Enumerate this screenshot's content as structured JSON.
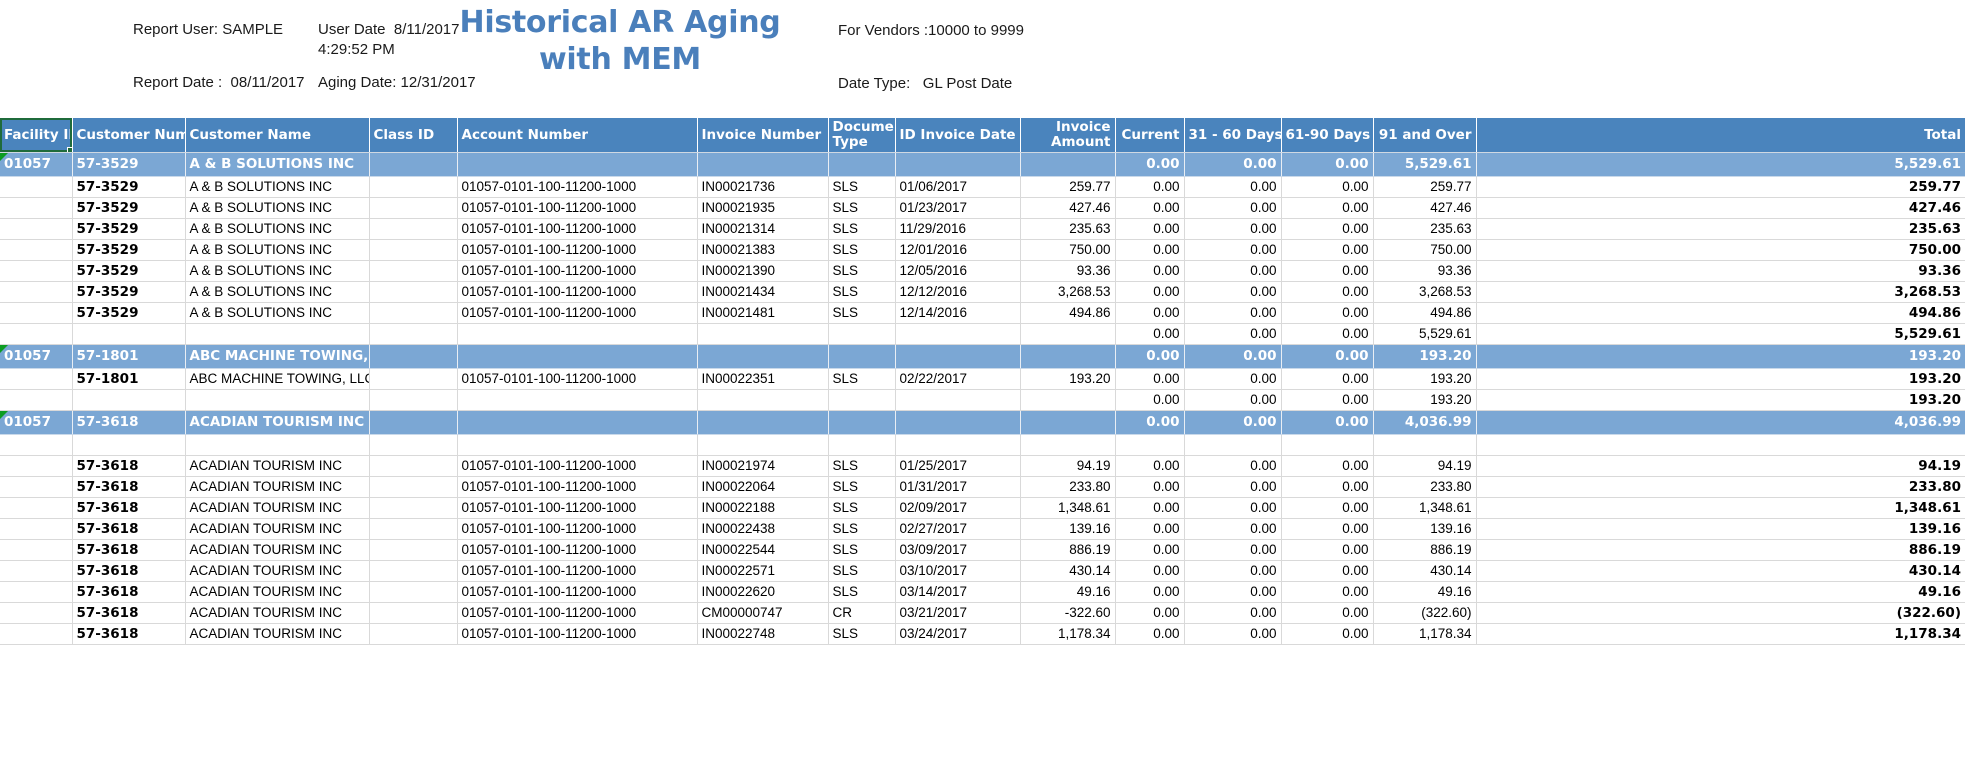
{
  "header": {
    "title_line1": "Historical AR Aging",
    "title_line2": "with MEM",
    "title_color": "#4a7fbb",
    "report_user": "Report User: SAMPLE",
    "user_date": "User Date  8/11/2017",
    "user_time": "4:29:52 PM",
    "report_date": "Report Date :  08/11/2017",
    "aging_date": "Aging Date: 12/31/2017",
    "for_vendors": "For Vendors :10000 to 9999",
    "date_type": "Date Type:   GL Post Date"
  },
  "table": {
    "columns": [
      "Facility ID",
      "Customer Number",
      "Customer Name",
      "Class ID",
      "Account Number",
      "Invoice Number",
      "Document Type",
      "ID Invoice Date",
      "Invoice Amount",
      "Current",
      "31 - 60 Days",
      "61-90 Days",
      "91 and Over",
      "Total"
    ],
    "selected_header": "Facility ID",
    "header_bg": "#4a84bd",
    "group_bg": "#7ba7d4",
    "rows": [
      {
        "kind": "group",
        "flagged": true,
        "facility": "01057",
        "customer_number": "57-3529",
        "customer_name": "A & B SOLUTIONS INC",
        "class_id": "",
        "account_number": "",
        "invoice_number": "",
        "doc_type": "",
        "invoice_date": "",
        "invoice_amount": "",
        "current": "0.00",
        "d31_60": "0.00",
        "d61_90": "0.00",
        "d91_over": "5,529.61",
        "total": "5,529.61"
      },
      {
        "kind": "detail",
        "facility": "",
        "customer_number": "57-3529",
        "customer_name": "A & B SOLUTIONS INC",
        "class_id": "",
        "account_number": "01057-0101-100-11200-1000",
        "invoice_number": "IN00021736",
        "doc_type": "SLS",
        "invoice_date": "01/06/2017",
        "invoice_amount": "259.77",
        "current": "0.00",
        "d31_60": "0.00",
        "d61_90": "0.00",
        "d91_over": "259.77",
        "total": "259.77"
      },
      {
        "kind": "detail",
        "facility": "",
        "customer_number": "57-3529",
        "customer_name": "A & B SOLUTIONS INC",
        "class_id": "",
        "account_number": "01057-0101-100-11200-1000",
        "invoice_number": "IN00021935",
        "doc_type": "SLS",
        "invoice_date": "01/23/2017",
        "invoice_amount": "427.46",
        "current": "0.00",
        "d31_60": "0.00",
        "d61_90": "0.00",
        "d91_over": "427.46",
        "total": "427.46"
      },
      {
        "kind": "detail",
        "facility": "",
        "customer_number": "57-3529",
        "customer_name": "A & B SOLUTIONS INC",
        "class_id": "",
        "account_number": "01057-0101-100-11200-1000",
        "invoice_number": "IN00021314",
        "doc_type": "SLS",
        "invoice_date": "11/29/2016",
        "invoice_amount": "235.63",
        "current": "0.00",
        "d31_60": "0.00",
        "d61_90": "0.00",
        "d91_over": "235.63",
        "total": "235.63"
      },
      {
        "kind": "detail",
        "facility": "",
        "customer_number": "57-3529",
        "customer_name": "A & B SOLUTIONS INC",
        "class_id": "",
        "account_number": "01057-0101-100-11200-1000",
        "invoice_number": "IN00021383",
        "doc_type": "SLS",
        "invoice_date": "12/01/2016",
        "invoice_amount": "750.00",
        "current": "0.00",
        "d31_60": "0.00",
        "d61_90": "0.00",
        "d91_over": "750.00",
        "total": "750.00"
      },
      {
        "kind": "detail",
        "facility": "",
        "customer_number": "57-3529",
        "customer_name": "A & B SOLUTIONS INC",
        "class_id": "",
        "account_number": "01057-0101-100-11200-1000",
        "invoice_number": "IN00021390",
        "doc_type": "SLS",
        "invoice_date": "12/05/2016",
        "invoice_amount": "93.36",
        "current": "0.00",
        "d31_60": "0.00",
        "d61_90": "0.00",
        "d91_over": "93.36",
        "total": "93.36"
      },
      {
        "kind": "detail",
        "facility": "",
        "customer_number": "57-3529",
        "customer_name": "A & B SOLUTIONS INC",
        "class_id": "",
        "account_number": "01057-0101-100-11200-1000",
        "invoice_number": "IN00021434",
        "doc_type": "SLS",
        "invoice_date": "12/12/2016",
        "invoice_amount": "3,268.53",
        "current": "0.00",
        "d31_60": "0.00",
        "d61_90": "0.00",
        "d91_over": "3,268.53",
        "total": "3,268.53"
      },
      {
        "kind": "detail",
        "facility": "",
        "customer_number": "57-3529",
        "customer_name": "A & B SOLUTIONS INC",
        "class_id": "",
        "account_number": "01057-0101-100-11200-1000",
        "invoice_number": "IN00021481",
        "doc_type": "SLS",
        "invoice_date": "12/14/2016",
        "invoice_amount": "494.86",
        "current": "0.00",
        "d31_60": "0.00",
        "d61_90": "0.00",
        "d91_over": "494.86",
        "total": "494.86"
      },
      {
        "kind": "subtotal",
        "facility": "",
        "customer_number": "",
        "customer_name": "",
        "class_id": "",
        "account_number": "",
        "invoice_number": "",
        "doc_type": "",
        "invoice_date": "",
        "invoice_amount": "",
        "current": "0.00",
        "d31_60": "0.00",
        "d61_90": "0.00",
        "d91_over": "5,529.61",
        "total": "5,529.61"
      },
      {
        "kind": "group",
        "flagged": true,
        "facility": "01057",
        "customer_number": "57-1801",
        "customer_name": "ABC MACHINE TOWING, LLC",
        "class_id": "",
        "account_number": "",
        "invoice_number": "",
        "doc_type": "",
        "invoice_date": "",
        "invoice_amount": "",
        "current": "0.00",
        "d31_60": "0.00",
        "d61_90": "0.00",
        "d91_over": "193.20",
        "total": "193.20"
      },
      {
        "kind": "detail",
        "facility": "",
        "customer_number": "57-1801",
        "customer_name": "ABC MACHINE TOWING, LLC",
        "class_id": "",
        "account_number": "01057-0101-100-11200-1000",
        "invoice_number": "IN00022351",
        "doc_type": "SLS",
        "invoice_date": "02/22/2017",
        "invoice_amount": "193.20",
        "current": "0.00",
        "d31_60": "0.00",
        "d61_90": "0.00",
        "d91_over": "193.20",
        "total": "193.20"
      },
      {
        "kind": "subtotal",
        "facility": "",
        "customer_number": "",
        "customer_name": "",
        "class_id": "",
        "account_number": "",
        "invoice_number": "",
        "doc_type": "",
        "invoice_date": "",
        "invoice_amount": "",
        "current": "0.00",
        "d31_60": "0.00",
        "d61_90": "0.00",
        "d91_over": "193.20",
        "total": "193.20"
      },
      {
        "kind": "group",
        "flagged": true,
        "facility": "01057",
        "customer_number": "57-3618",
        "customer_name": "ACADIAN TOURISM INC",
        "class_id": "",
        "account_number": "",
        "invoice_number": "",
        "doc_type": "",
        "invoice_date": "",
        "invoice_amount": "",
        "current": "0.00",
        "d31_60": "0.00",
        "d61_90": "0.00",
        "d91_over": "4,036.99",
        "total": "4,036.99"
      },
      {
        "kind": "blank"
      },
      {
        "kind": "detail",
        "facility": "",
        "customer_number": "57-3618",
        "customer_name": "ACADIAN TOURISM INC",
        "class_id": "",
        "account_number": "01057-0101-100-11200-1000",
        "invoice_number": "IN00021974",
        "doc_type": "SLS",
        "invoice_date": "01/25/2017",
        "invoice_amount": "94.19",
        "current": "0.00",
        "d31_60": "0.00",
        "d61_90": "0.00",
        "d91_over": "94.19",
        "total": "94.19"
      },
      {
        "kind": "detail",
        "facility": "",
        "customer_number": "57-3618",
        "customer_name": "ACADIAN TOURISM INC",
        "class_id": "",
        "account_number": "01057-0101-100-11200-1000",
        "invoice_number": "IN00022064",
        "doc_type": "SLS",
        "invoice_date": "01/31/2017",
        "invoice_amount": "233.80",
        "current": "0.00",
        "d31_60": "0.00",
        "d61_90": "0.00",
        "d91_over": "233.80",
        "total": "233.80"
      },
      {
        "kind": "detail",
        "facility": "",
        "customer_number": "57-3618",
        "customer_name": "ACADIAN TOURISM INC",
        "class_id": "",
        "account_number": "01057-0101-100-11200-1000",
        "invoice_number": "IN00022188",
        "doc_type": "SLS",
        "invoice_date": "02/09/2017",
        "invoice_amount": "1,348.61",
        "current": "0.00",
        "d31_60": "0.00",
        "d61_90": "0.00",
        "d91_over": "1,348.61",
        "total": "1,348.61"
      },
      {
        "kind": "detail",
        "facility": "",
        "customer_number": "57-3618",
        "customer_name": "ACADIAN TOURISM INC",
        "class_id": "",
        "account_number": "01057-0101-100-11200-1000",
        "invoice_number": "IN00022438",
        "doc_type": "SLS",
        "invoice_date": "02/27/2017",
        "invoice_amount": "139.16",
        "current": "0.00",
        "d31_60": "0.00",
        "d61_90": "0.00",
        "d91_over": "139.16",
        "total": "139.16"
      },
      {
        "kind": "detail",
        "facility": "",
        "customer_number": "57-3618",
        "customer_name": "ACADIAN TOURISM INC",
        "class_id": "",
        "account_number": "01057-0101-100-11200-1000",
        "invoice_number": "IN00022544",
        "doc_type": "SLS",
        "invoice_date": "03/09/2017",
        "invoice_amount": "886.19",
        "current": "0.00",
        "d31_60": "0.00",
        "d61_90": "0.00",
        "d91_over": "886.19",
        "total": "886.19"
      },
      {
        "kind": "detail",
        "facility": "",
        "customer_number": "57-3618",
        "customer_name": "ACADIAN TOURISM INC",
        "class_id": "",
        "account_number": "01057-0101-100-11200-1000",
        "invoice_number": "IN00022571",
        "doc_type": "SLS",
        "invoice_date": "03/10/2017",
        "invoice_amount": "430.14",
        "current": "0.00",
        "d31_60": "0.00",
        "d61_90": "0.00",
        "d91_over": "430.14",
        "total": "430.14"
      },
      {
        "kind": "detail",
        "facility": "",
        "customer_number": "57-3618",
        "customer_name": "ACADIAN TOURISM INC",
        "class_id": "",
        "account_number": "01057-0101-100-11200-1000",
        "invoice_number": "IN00022620",
        "doc_type": "SLS",
        "invoice_date": "03/14/2017",
        "invoice_amount": "49.16",
        "current": "0.00",
        "d31_60": "0.00",
        "d61_90": "0.00",
        "d91_over": "49.16",
        "total": "49.16"
      },
      {
        "kind": "detail",
        "facility": "",
        "customer_number": "57-3618",
        "customer_name": "ACADIAN TOURISM INC",
        "class_id": "",
        "account_number": "01057-0101-100-11200-1000",
        "invoice_number": "CM00000747",
        "doc_type": "CR",
        "invoice_date": "03/21/2017",
        "invoice_amount": "-322.60",
        "current": "0.00",
        "d31_60": "0.00",
        "d61_90": "0.00",
        "d91_over": "(322.60)",
        "total": "(322.60)"
      },
      {
        "kind": "detail",
        "facility": "",
        "customer_number": "57-3618",
        "customer_name": "ACADIAN TOURISM INC",
        "class_id": "",
        "account_number": "01057-0101-100-11200-1000",
        "invoice_number": "IN00022748",
        "doc_type": "SLS",
        "invoice_date": "03/24/2017",
        "invoice_amount": "1,178.34",
        "current": "0.00",
        "d31_60": "0.00",
        "d61_90": "0.00",
        "d91_over": "1,178.34",
        "total": "1,178.34"
      }
    ]
  }
}
